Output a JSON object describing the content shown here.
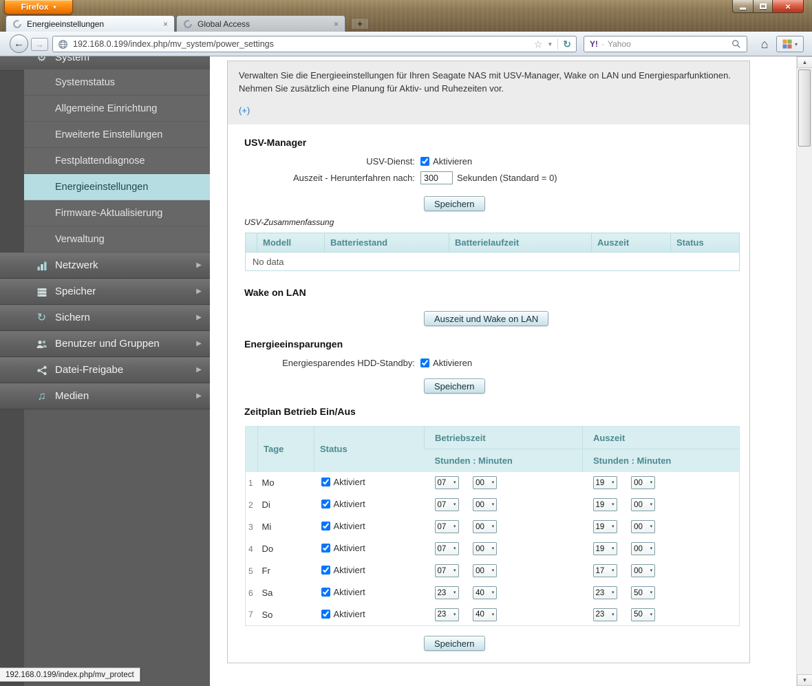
{
  "icons": {
    "caret_down": "▾",
    "close": "×",
    "chevron_right": "▶",
    "back": "←",
    "forward": "→",
    "reload": "↻",
    "star": "☆",
    "dropdown": "▼",
    "home": "⌂",
    "scroll_up": "▲",
    "scroll_down": "▼",
    "gear": "⚙",
    "backup_arrow": "↻",
    "media_note": "♫",
    "plus": "+"
  },
  "browser": {
    "menu_button_label": "Firefox",
    "tabs": [
      {
        "title": "Energieeinstellungen"
      },
      {
        "title": "Global Access"
      }
    ],
    "url": "192.168.0.199/index.php/mv_system/power_settings",
    "search_badge": "Y!",
    "search_separator": "·",
    "search_text": "Yahoo",
    "status_tooltip": "192.168.0.199/index.php/mv_protect"
  },
  "sidebar": {
    "items": [
      {
        "label": "System"
      },
      {
        "label": "Systemstatus"
      },
      {
        "label": "Allgemeine Einrichtung"
      },
      {
        "label": "Erweiterte Einstellungen"
      },
      {
        "label": "Festplattendiagnose"
      },
      {
        "label": "Energieeinstellungen"
      },
      {
        "label": "Firmware-Aktualisierung"
      },
      {
        "label": "Verwaltung"
      },
      {
        "label": "Netzwerk"
      },
      {
        "label": "Speicher"
      },
      {
        "label": "Sichern"
      },
      {
        "label": "Benutzer und Gruppen"
      },
      {
        "label": "Datei-Freigabe"
      },
      {
        "label": "Medien"
      }
    ]
  },
  "content": {
    "intro": "Verwalten Sie die Energieeinstellungen für Ihren Seagate NAS mit USV-Manager, Wake on LAN und Energiesparfunktionen. Nehmen Sie zusätzlich eine Planung für Aktiv- und Ruhezeiten vor.",
    "expand_link": "(+)",
    "ups": {
      "title": "USV-Manager",
      "service_label": "USV-Dienst:",
      "service_checkbox_label": "Aktivieren",
      "service_checked": true,
      "timeout_label": "Auszeit - Herunterfahren nach:",
      "timeout_value": "300",
      "timeout_suffix": "Sekunden (Standard = 0)",
      "save_label": "Speichern",
      "summary_label": "USV-Zusammenfassung",
      "table_headers": [
        "Modell",
        "Batteriestand",
        "Batterielaufzeit",
        "Auszeit",
        "Status"
      ],
      "table_empty": "No data"
    },
    "wol": {
      "title": "Wake on LAN",
      "button_label": "Auszeit und Wake on LAN"
    },
    "power_saving": {
      "title": "Energieeinsparungen",
      "hdd_label": "Energiesparendes HDD-Standby:",
      "hdd_checkbox_label": "Aktivieren",
      "hdd_checked": true,
      "save_label": "Speichern"
    },
    "schedule": {
      "title": "Zeitplan Betrieb Ein/Aus",
      "col_days": "Tage",
      "col_status": "Status",
      "col_on": "Betriebszeit",
      "col_off": "Auszeit",
      "col_sub": "Stunden : Minuten",
      "row_status_label": "Aktiviert",
      "rows": [
        {
          "num": "1",
          "day": "Mo",
          "enabled": true,
          "on_hour": "07",
          "on_min": "00",
          "off_hour": "19",
          "off_min": "00"
        },
        {
          "num": "2",
          "day": "Di",
          "enabled": true,
          "on_hour": "07",
          "on_min": "00",
          "off_hour": "19",
          "off_min": "00"
        },
        {
          "num": "3",
          "day": "Mi",
          "enabled": true,
          "on_hour": "07",
          "on_min": "00",
          "off_hour": "19",
          "off_min": "00"
        },
        {
          "num": "4",
          "day": "Do",
          "enabled": true,
          "on_hour": "07",
          "on_min": "00",
          "off_hour": "19",
          "off_min": "00"
        },
        {
          "num": "5",
          "day": "Fr",
          "enabled": true,
          "on_hour": "07",
          "on_min": "00",
          "off_hour": "17",
          "off_min": "00"
        },
        {
          "num": "6",
          "day": "Sa",
          "enabled": true,
          "on_hour": "23",
          "on_min": "40",
          "off_hour": "23",
          "off_min": "50"
        },
        {
          "num": "7",
          "day": "So",
          "enabled": true,
          "on_hour": "23",
          "on_min": "40",
          "off_hour": "23",
          "off_min": "50"
        }
      ],
      "save_label": "Speichern"
    }
  }
}
